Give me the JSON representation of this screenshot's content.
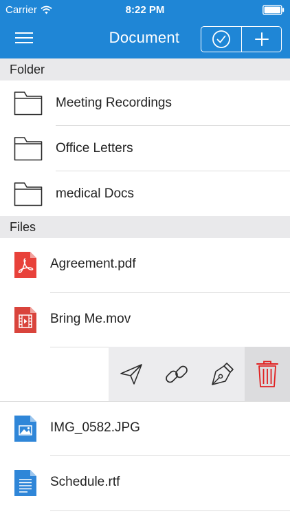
{
  "status_bar": {
    "carrier": "Carrier",
    "time": "8:22 PM"
  },
  "nav": {
    "title": "Document",
    "menu_icon": "hamburger-menu-icon",
    "select_icon": "checkmark-circle-icon",
    "add_icon": "plus-icon"
  },
  "folders": {
    "header": "Folder",
    "items": [
      {
        "label": "Meeting Recordings",
        "icon": "folder-icon"
      },
      {
        "label": "Office Letters",
        "icon": "folder-icon"
      },
      {
        "label": "medical Docs",
        "icon": "folder-icon"
      }
    ]
  },
  "files": {
    "header": "Files",
    "items": [
      {
        "label": "Agreement.pdf",
        "icon": "pdf-file-icon"
      },
      {
        "label": "Bring Me.mov",
        "icon": "video-file-icon"
      },
      {
        "label": "IMG_0582.JPG",
        "icon": "image-file-icon"
      },
      {
        "label": "Schedule.rtf",
        "icon": "document-file-icon"
      }
    ]
  },
  "swipe_actions": [
    {
      "icon": "send-icon"
    },
    {
      "icon": "link-icon"
    },
    {
      "icon": "pen-nib-icon"
    },
    {
      "icon": "trash-icon",
      "color": "#e02020"
    }
  ],
  "colors": {
    "brand": "#1f86d6",
    "section_bg": "#e9e9eb",
    "pdf": "#e8413a",
    "video": "#d9443c",
    "image": "#2f86d8",
    "doc": "#2f86d8",
    "delete": "#e02020"
  }
}
